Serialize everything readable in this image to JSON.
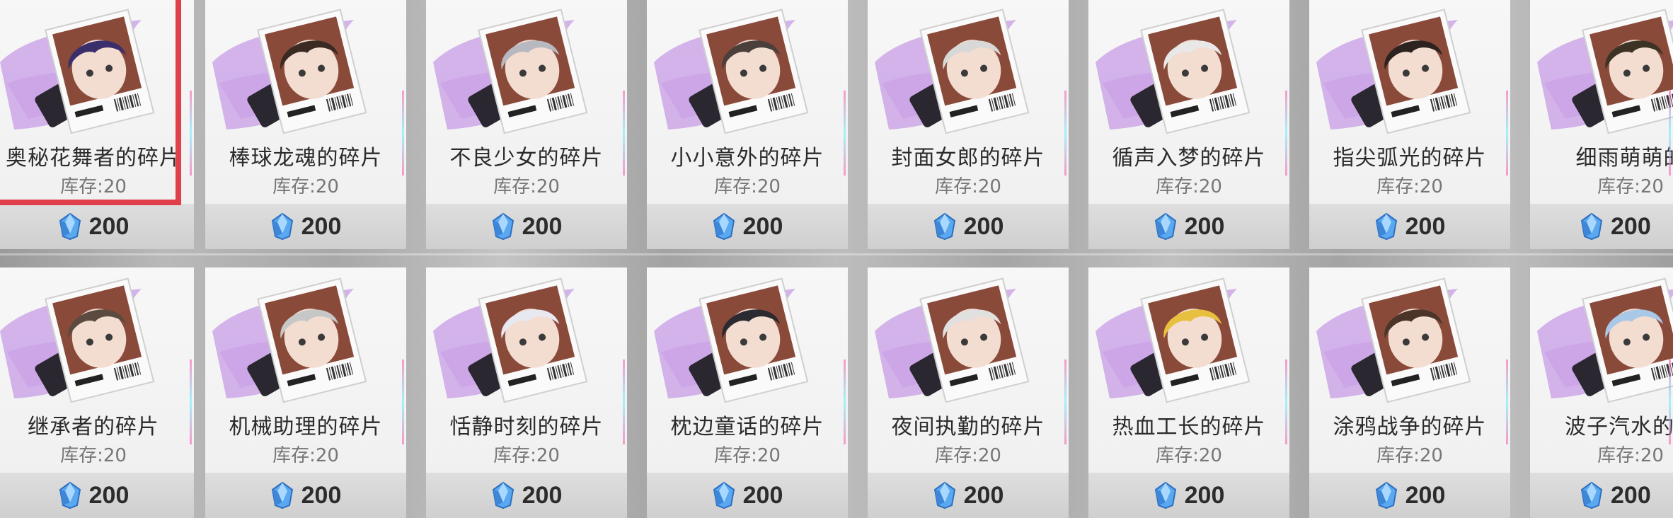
{
  "colors": {
    "selected_border": "#e0404a",
    "accent_purple": "#b67be0",
    "gem_blue": "#4aa7ff"
  },
  "currency_icon": "blue-crystal-gem-icon",
  "items": [
    {
      "name": "奥秘花舞者的碎片",
      "stock": "库存:20",
      "price": "200",
      "selected": true
    },
    {
      "name": "棒球龙魂的碎片",
      "stock": "库存:20",
      "price": "200"
    },
    {
      "name": "不良少女的碎片",
      "stock": "库存:20",
      "price": "200"
    },
    {
      "name": "小小意外的碎片",
      "stock": "库存:20",
      "price": "200"
    },
    {
      "name": "封面女郎的碎片",
      "stock": "库存:20",
      "price": "200"
    },
    {
      "name": "循声入梦的碎片",
      "stock": "库存:20",
      "price": "200"
    },
    {
      "name": "指尖弧光的碎片",
      "stock": "库存:20",
      "price": "200"
    },
    {
      "name": "细雨萌萌的",
      "stock": "库存:20",
      "price": "200",
      "partial": true
    },
    {
      "name": "继承者的碎片",
      "stock": "库存:20",
      "price": "200"
    },
    {
      "name": "机械助理的碎片",
      "stock": "库存:20",
      "price": "200"
    },
    {
      "name": "恬静时刻的碎片",
      "stock": "库存:20",
      "price": "200"
    },
    {
      "name": "枕边童话的碎片",
      "stock": "库存:20",
      "price": "200"
    },
    {
      "name": "夜间执勤的碎片",
      "stock": "库存:20",
      "price": "200"
    },
    {
      "name": "热血工长的碎片",
      "stock": "库存:20",
      "price": "200"
    },
    {
      "name": "涂鸦战争的碎片",
      "stock": "库存:20",
      "price": "200"
    },
    {
      "name": "波子汽水的碎",
      "stock": "库存:20",
      "price": "200",
      "partial": true
    }
  ]
}
